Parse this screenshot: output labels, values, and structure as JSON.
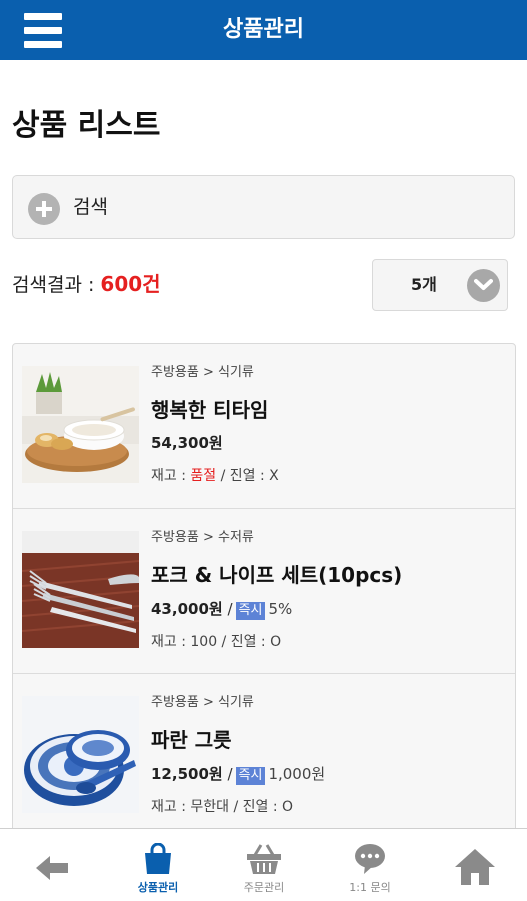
{
  "header": {
    "title": "상품관리",
    "menu_icon": "hamburger-icon"
  },
  "page_title": "상품 리스트",
  "search": {
    "label": "검색",
    "icon": "plus-circle-icon"
  },
  "result": {
    "prefix": "검색결과 : ",
    "count": "600건"
  },
  "per_page": {
    "value": "5개",
    "icon": "chevron-down-icon"
  },
  "colors": {
    "brand": "#0a5fae",
    "accent_red": "#e52020",
    "badge_blue": "#5d83d6"
  },
  "products": [
    {
      "category": "주방용품 > 식기류",
      "name": "행복한 티타임",
      "price": "54,300원",
      "stock_prefix": "재고 : ",
      "stock_value": "품절",
      "stock_suffix": " / 진열 : X"
    },
    {
      "category": "주방용품 > 수저류",
      "name": "포크 & 나이프 세트(10pcs)",
      "price": "43,000원",
      "sep": " /",
      "badge": "즉시",
      "extra": "5%",
      "stock": "재고 : 100 / 진열 : O"
    },
    {
      "category": "주방용품 > 식기류",
      "name": "파란 그릇",
      "price": "12,500원",
      "sep": " /",
      "badge": "즉시",
      "extra": "1,000원",
      "stock": "재고 : 무한대 / 진열 : O"
    }
  ],
  "bottom_nav": [
    {
      "label": "",
      "icon": "back-arrow-icon"
    },
    {
      "label": "상품관리",
      "icon": "shopping-bag-icon",
      "active": true
    },
    {
      "label": "주문관리",
      "icon": "basket-icon"
    },
    {
      "label": "1:1 문의",
      "icon": "chat-bubble-icon"
    },
    {
      "label": "",
      "icon": "home-icon"
    }
  ]
}
